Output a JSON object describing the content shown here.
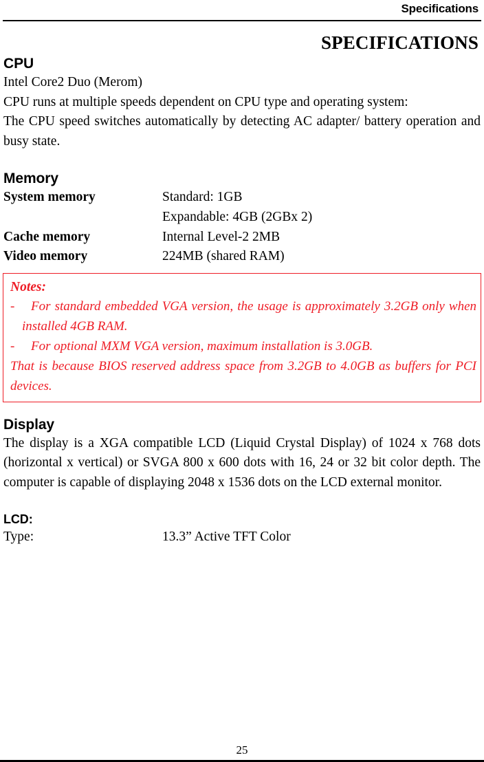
{
  "header": {
    "running_title": "Specifications"
  },
  "chapter": {
    "title": "SPECIFICATIONS"
  },
  "sections": {
    "cpu": {
      "heading": "CPU",
      "paragraphs": [
        "Intel Core2 Duo (Merom)",
        "CPU runs at multiple speeds dependent on CPU type and operating system:",
        "The CPU speed switches automatically by detecting AC adapter/ battery operation and busy state."
      ]
    },
    "memory": {
      "heading": "Memory",
      "rows": [
        {
          "label": "System memory",
          "values": [
            "Standard: 1GB",
            "Expandable: 4GB (2GBx 2)"
          ]
        },
        {
          "label": "Cache memory",
          "values": [
            "Internal Level-2 2MB"
          ]
        },
        {
          "label": "Video memory",
          "values": [
            "224MB (shared RAM)"
          ]
        }
      ],
      "notes": {
        "title": "Notes:",
        "dash": "-",
        "items": [
          "For standard embedded VGA version, the usage is approximately 3.2GB only when installed 4GB RAM.",
          "For optional MXM VGA version, maximum installation is 3.0GB."
        ],
        "tail": "That is because BIOS reserved address space from 3.2GB to 4.0GB as buffers for PCI devices.",
        "color": "#EE1C25"
      }
    },
    "display": {
      "heading": "Display",
      "paragraphs": [
        "The display is a XGA compatible LCD (Liquid Crystal Display) of 1024 x 768 dots (horizontal x vertical) or SVGA 800 x 600 dots with 16, 24 or 32 bit color depth. The computer is capable of displaying 2048 x 1536 dots on the LCD external monitor."
      ]
    },
    "lcd": {
      "heading": "LCD:",
      "rows": [
        {
          "label": "Type:",
          "values": [
            "13.3” Active TFT Color"
          ]
        }
      ]
    }
  },
  "footer": {
    "page_number": "25"
  }
}
